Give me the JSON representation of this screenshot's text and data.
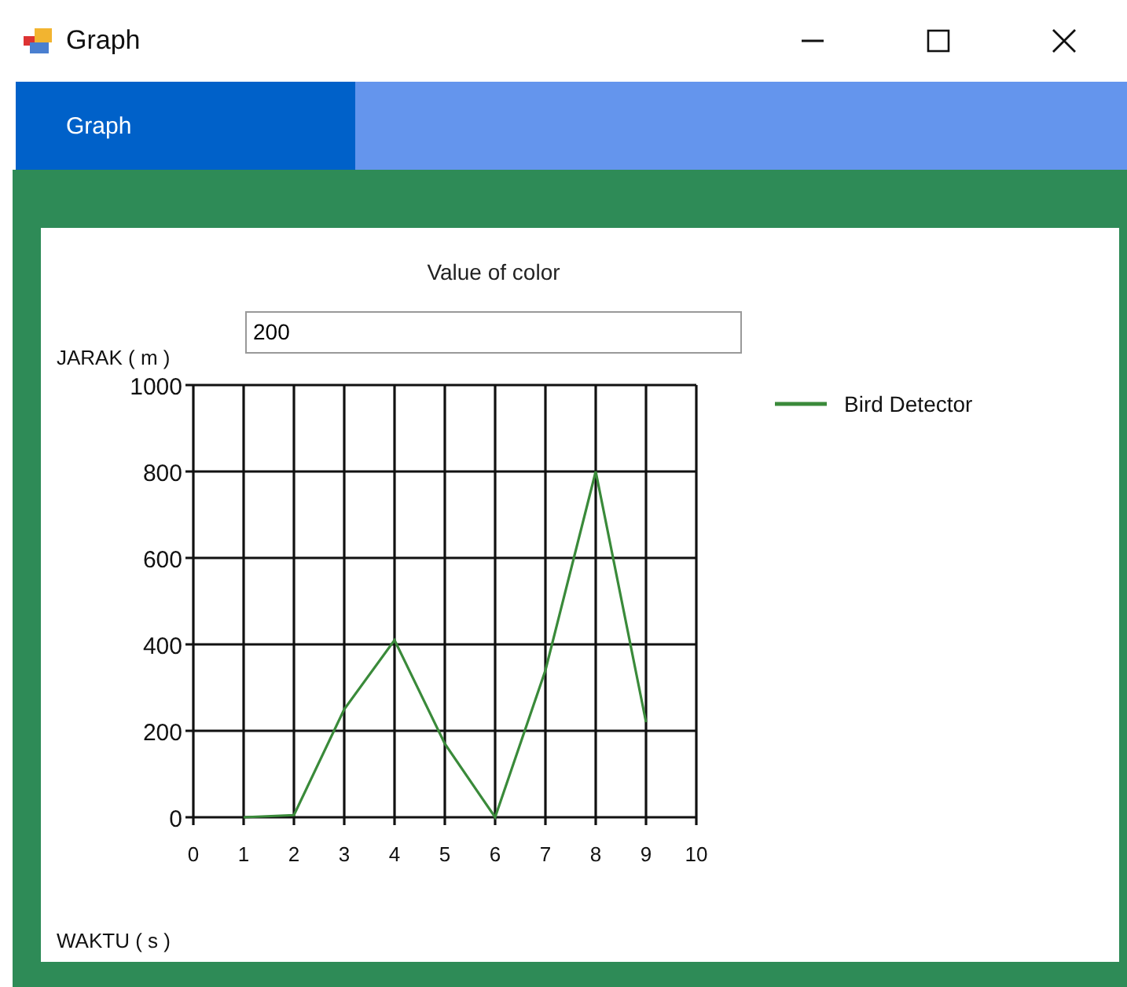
{
  "window": {
    "title": "Graph"
  },
  "menu": [
    {
      "label": "Graph",
      "selected": true
    }
  ],
  "color_field": {
    "label": "Value of color",
    "value": "200"
  },
  "chart_data": {
    "type": "line",
    "xlabel": "WAKTU ( s )",
    "ylabel": "JARAK ( m )",
    "x": [
      1,
      2,
      3,
      4,
      5,
      6,
      7,
      8,
      9
    ],
    "series": [
      {
        "name": "Bird Detector",
        "color": "#3a8a3a",
        "values": [
          0,
          5,
          250,
          410,
          170,
          0,
          340,
          800,
          220
        ]
      }
    ],
    "grid": true,
    "xlim": [
      0,
      10
    ],
    "ylim": [
      0,
      1000
    ],
    "xticks": [
      0,
      1,
      2,
      3,
      4,
      5,
      6,
      7,
      8,
      9,
      10
    ],
    "yticks": [
      0,
      200,
      400,
      600,
      800,
      1000
    ]
  }
}
